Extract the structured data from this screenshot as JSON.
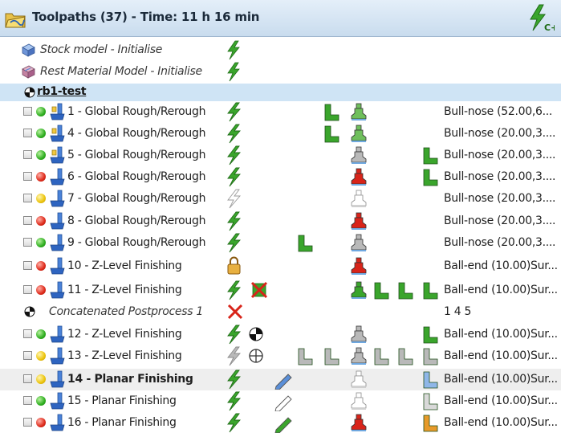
{
  "header": {
    "title": "Toolpaths (37) - Time: 11 h 16 min",
    "folder_icon": "toolpath-folder-icon",
    "calculate_icon": "calculate-all-icon"
  },
  "colors": {
    "header_bg": "#cfe1f1",
    "section_bg": "#cfe4f5",
    "selected_row_bg": "#eeeeee",
    "status_green": "#2fae20",
    "status_red": "#de2b1b",
    "status_yellow": "#ecc40c",
    "calc_green": "#3aa52c"
  },
  "tree": {
    "stock_model": "Stock model - Initialise",
    "rest_model": "Rest Material Model - Initialise",
    "group": "rb1-test",
    "concat_label": "Concatenated Postprocess 1",
    "concat_value": "1 4 5"
  },
  "rows": [
    {
      "label": "1 - Global Rough/Rerough",
      "tool": "Bull-nose (52.00,6...",
      "status": "green"
    },
    {
      "label": "4 - Global Rough/Rerough",
      "tool": "Bull-nose (20.00,3....",
      "status": "green"
    },
    {
      "label": "5 - Global Rough/Rerough",
      "tool": "Bull-nose (20.00,3....",
      "status": "green"
    },
    {
      "label": "6 - Global Rough/Rerough",
      "tool": "Bull-nose (20.00,3....",
      "status": "red"
    },
    {
      "label": "7 - Global Rough/Rerough",
      "tool": "Bull-nose (20.00,3....",
      "status": "yellow"
    },
    {
      "label": "8 - Global Rough/Rerough",
      "tool": "Bull-nose (20.00,3....",
      "status": "red"
    },
    {
      "label": "9 - Global Rough/Rerough",
      "tool": "Bull-nose (20.00,3....",
      "status": "green"
    },
    {
      "label": "10 - Z-Level Finishing",
      "tool": "Ball-end (10.00)Sur...",
      "status": "red"
    },
    {
      "label": "11 - Z-Level Finishing",
      "tool": "Ball-end (10.00)Sur...",
      "status": "red"
    },
    {
      "label": "12 - Z-Level Finishing",
      "tool": "Ball-end (10.00)Sur...",
      "status": "green"
    },
    {
      "label": "13 - Z-Level Finishing",
      "tool": "Ball-end (10.00)Sur...",
      "status": "yellow"
    },
    {
      "label": "14 - Planar Finishing",
      "tool": "Ball-end (10.00)Sur...",
      "status": "yellow"
    },
    {
      "label": "15 - Planar Finishing",
      "tool": "Ball-end (10.00)Sur...",
      "status": "green"
    },
    {
      "label": "16 - Planar Finishing",
      "tool": "Ball-end (10.00)Sur...",
      "status": "red"
    }
  ]
}
